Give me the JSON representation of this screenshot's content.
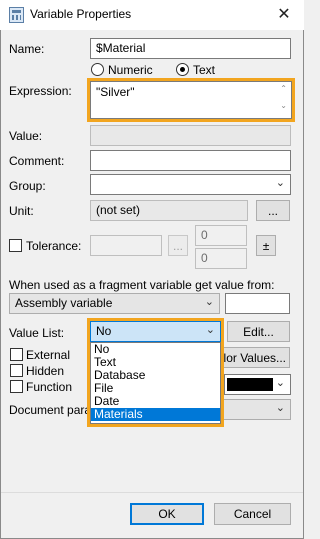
{
  "window": {
    "title": "Variable Properties",
    "close_glyph": "✕"
  },
  "form": {
    "name_label": "Name:",
    "name_value": "$Material",
    "radio_numeric": "Numeric",
    "radio_text": "Text",
    "expression_label": "Expression:",
    "expression_value": "\"Silver\"",
    "value_label": "Value:",
    "comment_label": "Comment:",
    "group_label": "Group:",
    "unit_label": "Unit:",
    "unit_value": "(not set)",
    "unit_button": "...",
    "tolerance_label": "Tolerance:",
    "tolerance_button": "...",
    "tolerance_upper": "0",
    "tolerance_lower": "0",
    "plusminus_button": "±",
    "fragment_label": "When used as a fragment variable get value from:",
    "fragment_value": "Assembly variable",
    "value_list_label": "Value List:",
    "value_list_value": "No",
    "edit_button": "Edit...",
    "external_label": "External",
    "hidden_label": "Hidden",
    "function_label": "Function",
    "color_values_button": "Color Values...",
    "document_param_label": "Document parameter:"
  },
  "dropdown": {
    "options": [
      "No",
      "Text",
      "Database",
      "File",
      "Date",
      "Materials"
    ],
    "selected_index": 5
  },
  "footer": {
    "ok_label": "OK",
    "cancel_label": "Cancel"
  },
  "colors": {
    "highlight": "#f2a51f",
    "selection": "#0078d7"
  }
}
